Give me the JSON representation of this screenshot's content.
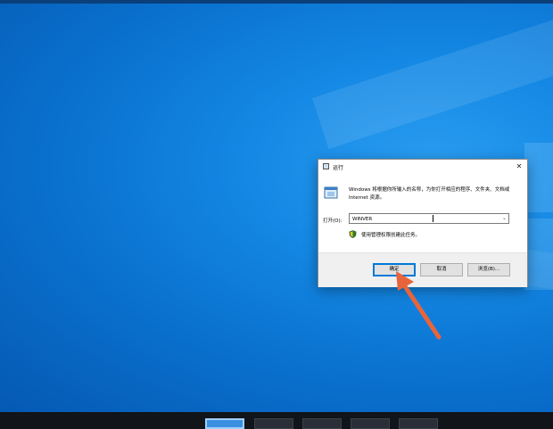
{
  "dialog": {
    "title": "运行",
    "close_label": "✕",
    "description": "Windows 将根据你所输入的名称，为你打开相应的程序、文件夹、文档或 Internet 资源。",
    "open_label": "打开(O):",
    "open_value": "WINVER",
    "admin_note": "使用管理权限创建此任务。",
    "buttons": {
      "ok": "确定",
      "cancel": "取消",
      "browse": "浏览(B)..."
    }
  },
  "colors": {
    "desktop_blue": "#0a7ad6",
    "accent": "#0078d7",
    "arrow": "#e8643c"
  },
  "taskbar": {
    "thumbnails": [
      "thumb-1",
      "thumb-2",
      "thumb-3",
      "thumb-4",
      "thumb-5"
    ]
  }
}
